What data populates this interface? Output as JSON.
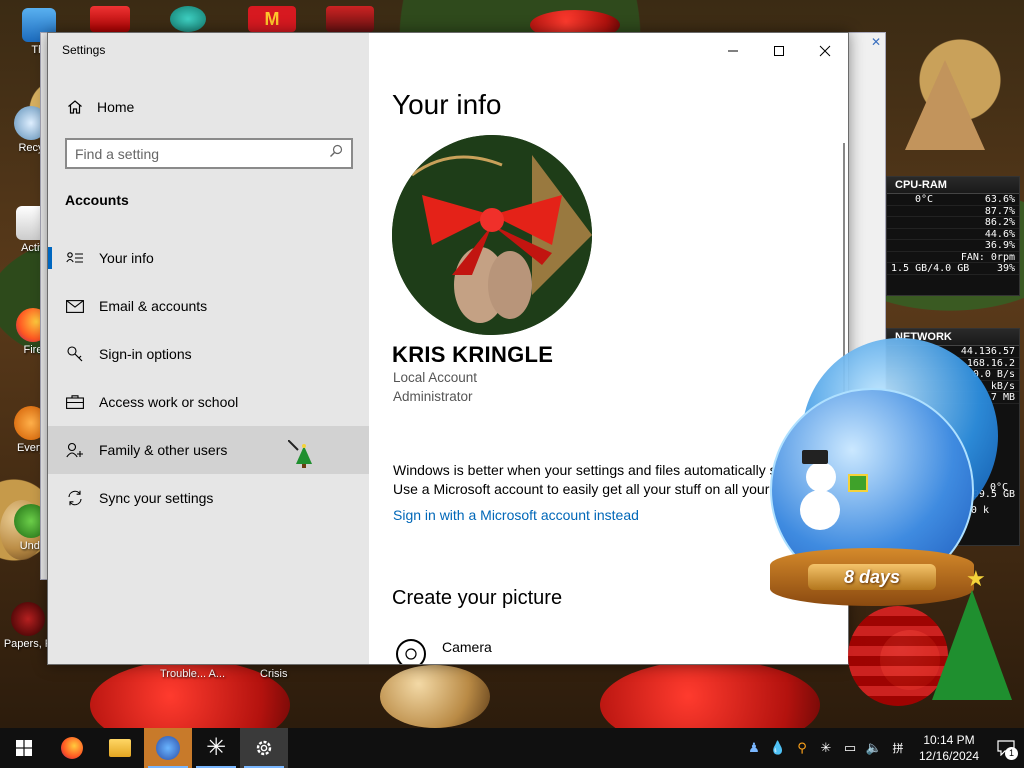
{
  "desktop": {
    "icons": [
      {
        "label": "Thi"
      },
      {
        "label": "Recy"
      },
      {
        "label": "Activ"
      },
      {
        "label": "Fire"
      },
      {
        "label": "Every"
      },
      {
        "label": "Undi"
      },
      {
        "label": "Papers, P"
      }
    ],
    "bottom_labels": [
      "Trouble... A...",
      "Crisis"
    ]
  },
  "cpu_widget": {
    "title": "CPU-RAM",
    "temp": "0°C",
    "usage_total": "63.6%",
    "cores": [
      "87.7%",
      "86.2%",
      "44.6%",
      "36.9%"
    ],
    "fan": "FAN: 0rpm",
    "ram": "1.5 GB/4.0 GB",
    "ram_pct": "39%"
  },
  "network_widget": {
    "title": "NETWORK",
    "rows": [
      "44.136.57",
      "168.16.2",
      "0.0 B/s",
      "kB/s",
      "7 MB"
    ],
    "extra": [
      "99.5 GB",
      "3.0 k"
    ]
  },
  "snow_globe": {
    "countdown": "8 days",
    "temp": "0°C"
  },
  "settings": {
    "window_title": "Settings",
    "home_label": "Home",
    "search_placeholder": "Find a setting",
    "section": "Accounts",
    "nav": [
      {
        "label": "Your info",
        "icon": "contact-card-icon"
      },
      {
        "label": "Email & accounts",
        "icon": "mail-icon"
      },
      {
        "label": "Sign-in options",
        "icon": "key-icon"
      },
      {
        "label": "Access work or school",
        "icon": "briefcase-icon"
      },
      {
        "label": "Family & other users",
        "icon": "add-person-icon"
      },
      {
        "label": "Sync your settings",
        "icon": "sync-icon"
      }
    ],
    "selected_index": 0,
    "hover_index": 4,
    "content": {
      "title": "Your info",
      "user_name": "KRIS KRINGLE",
      "account_type": "Local Account",
      "role": "Administrator",
      "info_line1": "Windows is better when your settings and files automatically s",
      "info_line2": "Use a Microsoft account to easily get all your stuff on all your",
      "signin_link": "Sign in with a Microsoft account instead",
      "create_picture_heading": "Create your picture",
      "camera_label": "Camera"
    }
  },
  "taskbar": {
    "apps": [
      "start-icon",
      "firefox-icon",
      "file-explorer-icon",
      "app-icon",
      "snowflake-app-icon",
      "settings-gear-icon"
    ],
    "time": "10:14 PM",
    "date": "12/16/2024",
    "notification_count": "1"
  },
  "colors": {
    "accent": "#0067c0",
    "link": "#0067b8",
    "sidebar_bg": "#e6e6e6",
    "taskbar_bg": "#101010"
  }
}
